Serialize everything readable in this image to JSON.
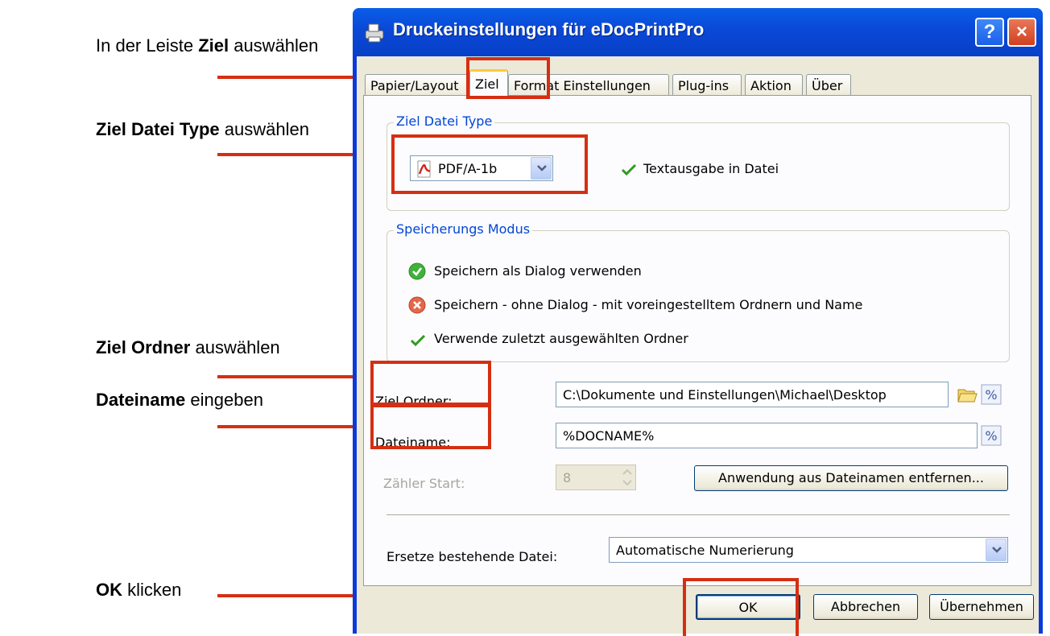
{
  "instructions": [
    {
      "bold": "",
      "prefix": "In der Leiste ",
      "bold_word": "Ziel",
      "suffix": " auswählen"
    },
    {
      "bold_word": "Ziel Datei Type",
      "suffix": " auswählen"
    },
    {
      "bold_word": "Ziel Ordner",
      "suffix": " auswählen"
    },
    {
      "bold_word": "Dateiname",
      "suffix": " eingeben"
    },
    {
      "bold_word": "OK",
      "suffix": " klicken"
    }
  ],
  "dialog": {
    "title": "Druckeinstellungen für eDocPrintPro",
    "help_label": "?",
    "close_label": "×"
  },
  "tabs": [
    {
      "label": "Papier/Layout",
      "active": false
    },
    {
      "label": "Ziel",
      "active": true
    },
    {
      "label": "Format Einstellungen",
      "active": false
    },
    {
      "label": "Plug-ins",
      "active": false
    },
    {
      "label": "Aktion",
      "active": false
    },
    {
      "label": "Über",
      "active": false
    }
  ],
  "file_type_group": {
    "legend": "Ziel Datei Type",
    "selected": "PDF/A-1b",
    "text_output_label": "Textausgabe in Datei"
  },
  "save_mode_group": {
    "legend": "Speicherungs Modus",
    "options": [
      {
        "label": "Speichern als Dialog verwenden",
        "status": "on"
      },
      {
        "label": "Speichern - ohne Dialog - mit voreingestelltem Ordnern und Name",
        "status": "off"
      },
      {
        "label": "Verwende zuletzt ausgewählten Ordner",
        "status": "check"
      }
    ]
  },
  "fields": {
    "target_folder_label": "Ziel Ordner:",
    "target_folder_value": "C:\\Dokumente und Einstellungen\\Michael\\Desktop",
    "filename_label": "Dateiname:",
    "filename_value": "%DOCNAME%",
    "counter_label": "Zähler Start:",
    "counter_value": "8",
    "remove_app_button": "Anwendung aus Dateinamen entfernen...",
    "replace_label": "Ersetze bestehende Datei:",
    "replace_value": "Automatische Numerierung"
  },
  "buttons": {
    "ok": "OK",
    "cancel": "Abbrechen",
    "apply": "Übernehmen"
  },
  "colors": {
    "annotation_red": "#d62e12",
    "xp_title_blue": "#0a48d6",
    "group_legend_blue": "#0046d5"
  }
}
